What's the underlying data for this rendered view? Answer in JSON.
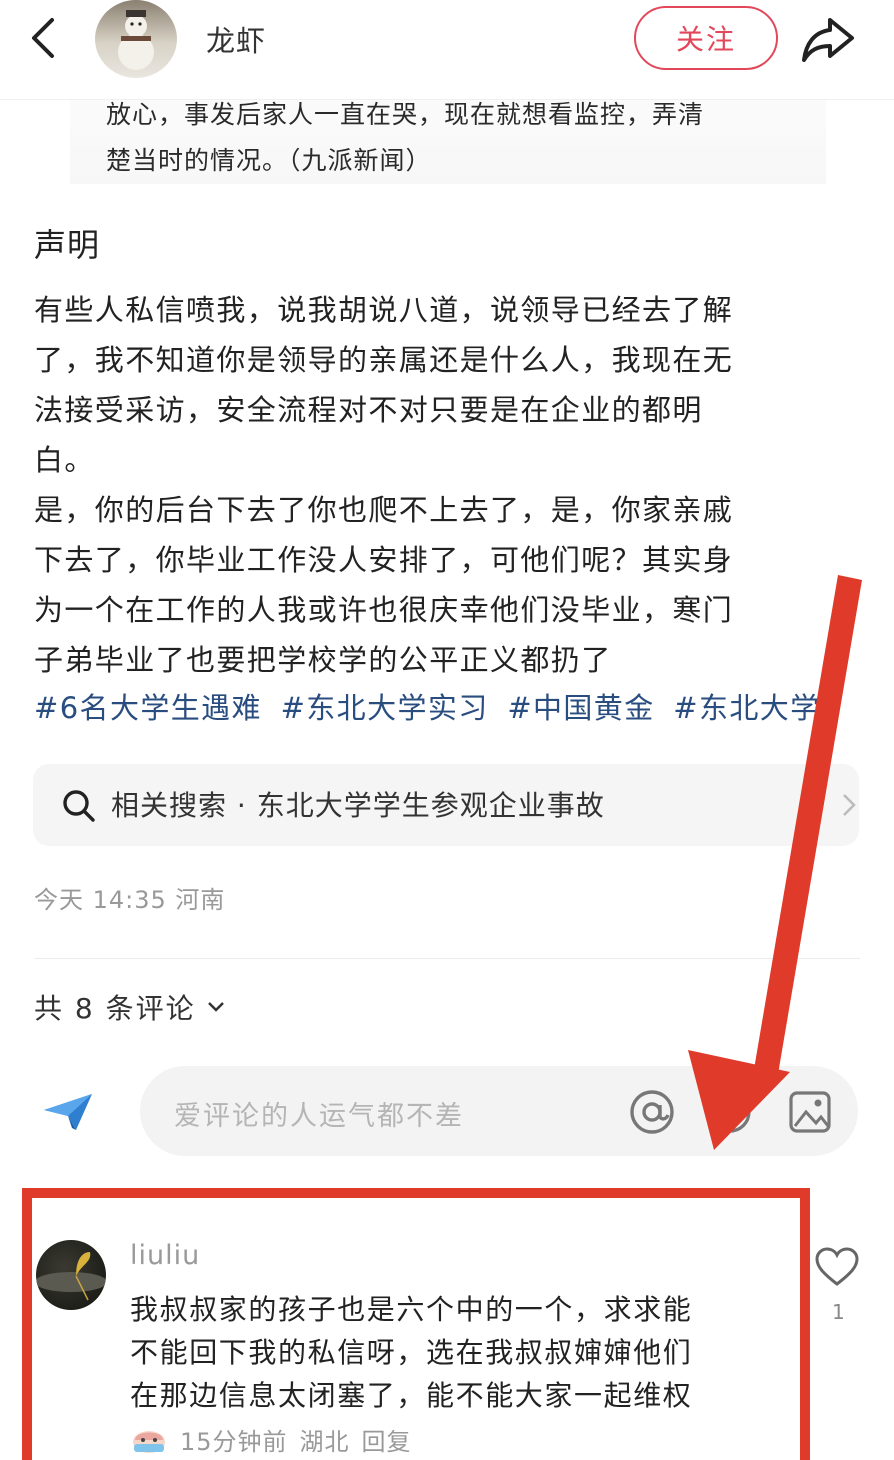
{
  "header": {
    "author_name": "龙虾",
    "follow_label": "关注"
  },
  "quote": {
    "lines": [
      "放心，事发后家人一直在哭，现在就想看监控，弄清",
      "楚当时的情况。（九派新闻）"
    ]
  },
  "article": {
    "section_title": "声明",
    "lines": [
      "有些人私信喷我，说我胡说八道，说领导已经去了解",
      "了，我不知道你是领导的亲属还是什么人，我现在无",
      "法接受采访，安全流程对不对只要是在企业的都明",
      "白。",
      "是，你的后台下去了你也爬不上去了，是，你家亲戚",
      "下去了，你毕业工作没人安排了，可他们呢？其实身",
      "为一个在工作的人我或许也很庆幸他们没毕业，寒门",
      "子弟毕业了也要把学校学的公平正义都扔了"
    ],
    "tags": [
      "#6名大学生遇难",
      "#东北大学实习",
      "#中国黄金",
      "#东北大学"
    ]
  },
  "related_search": {
    "text": "相关搜索 · 东北大学学生参观企业事故",
    "icon": "search-icon"
  },
  "post_meta": {
    "text": "今天 14:35 河南"
  },
  "comments": {
    "count_label": "共 8 条评论",
    "input_placeholder": "爱评论的人运气都不差",
    "items": [
      {
        "user": "liuliu",
        "lines": [
          "我叔叔家的孩子也是六个中的一个，求求能",
          "不能回下我的私信呀，选在我叔叔婶婶他们",
          "在那边信息太闭塞了，能不能大家一起维权"
        ],
        "time": "15分钟前",
        "location": "湖北",
        "reply_label": "回复",
        "likes": "1"
      }
    ]
  },
  "colors": {
    "accent_red": "#e2485a",
    "hashtag_blue": "#2a4d80",
    "annotation_red": "#e03b2a"
  }
}
